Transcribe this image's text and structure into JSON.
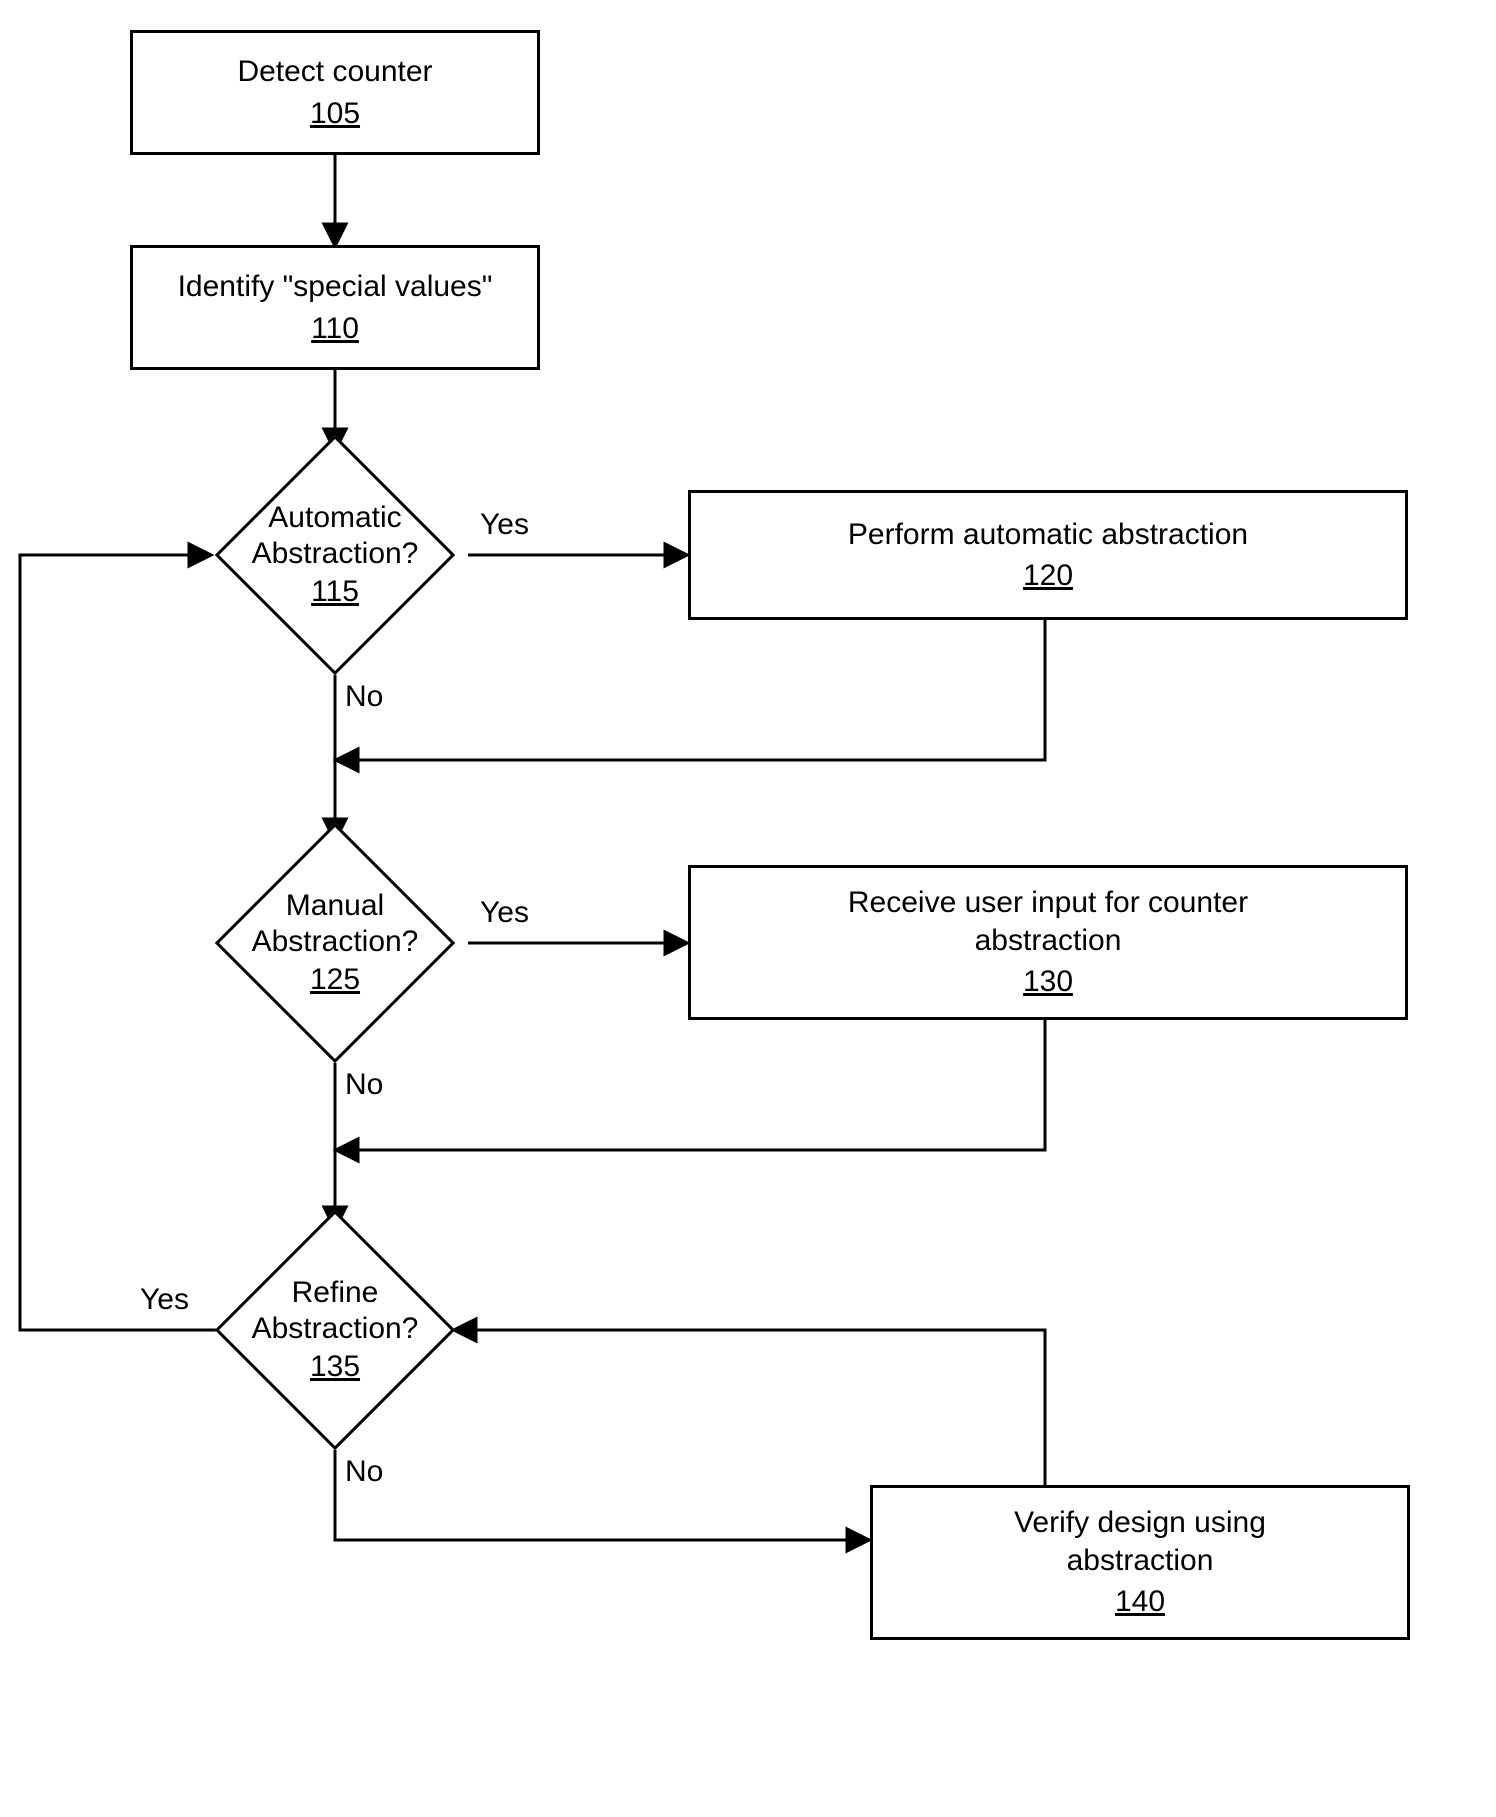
{
  "nodes": {
    "n105": {
      "title": "Detect counter",
      "ref": "105"
    },
    "n110": {
      "title": "Identify \"special values\"",
      "ref": "110"
    },
    "n115": {
      "line1": "Automatic",
      "line2": "Abstraction?",
      "ref": "115"
    },
    "n120": {
      "title": "Perform automatic abstraction",
      "ref": "120"
    },
    "n125": {
      "line1": "Manual",
      "line2": "Abstraction?",
      "ref": "125"
    },
    "n130": {
      "line1": "Receive user input for counter",
      "line2": "abstraction",
      "ref": "130"
    },
    "n135": {
      "line1": "Refine",
      "line2": "Abstraction?",
      "ref": "135"
    },
    "n140": {
      "line1": "Verify design using",
      "line2": "abstraction",
      "ref": "140"
    }
  },
  "labels": {
    "yes": "Yes",
    "no": "No"
  }
}
